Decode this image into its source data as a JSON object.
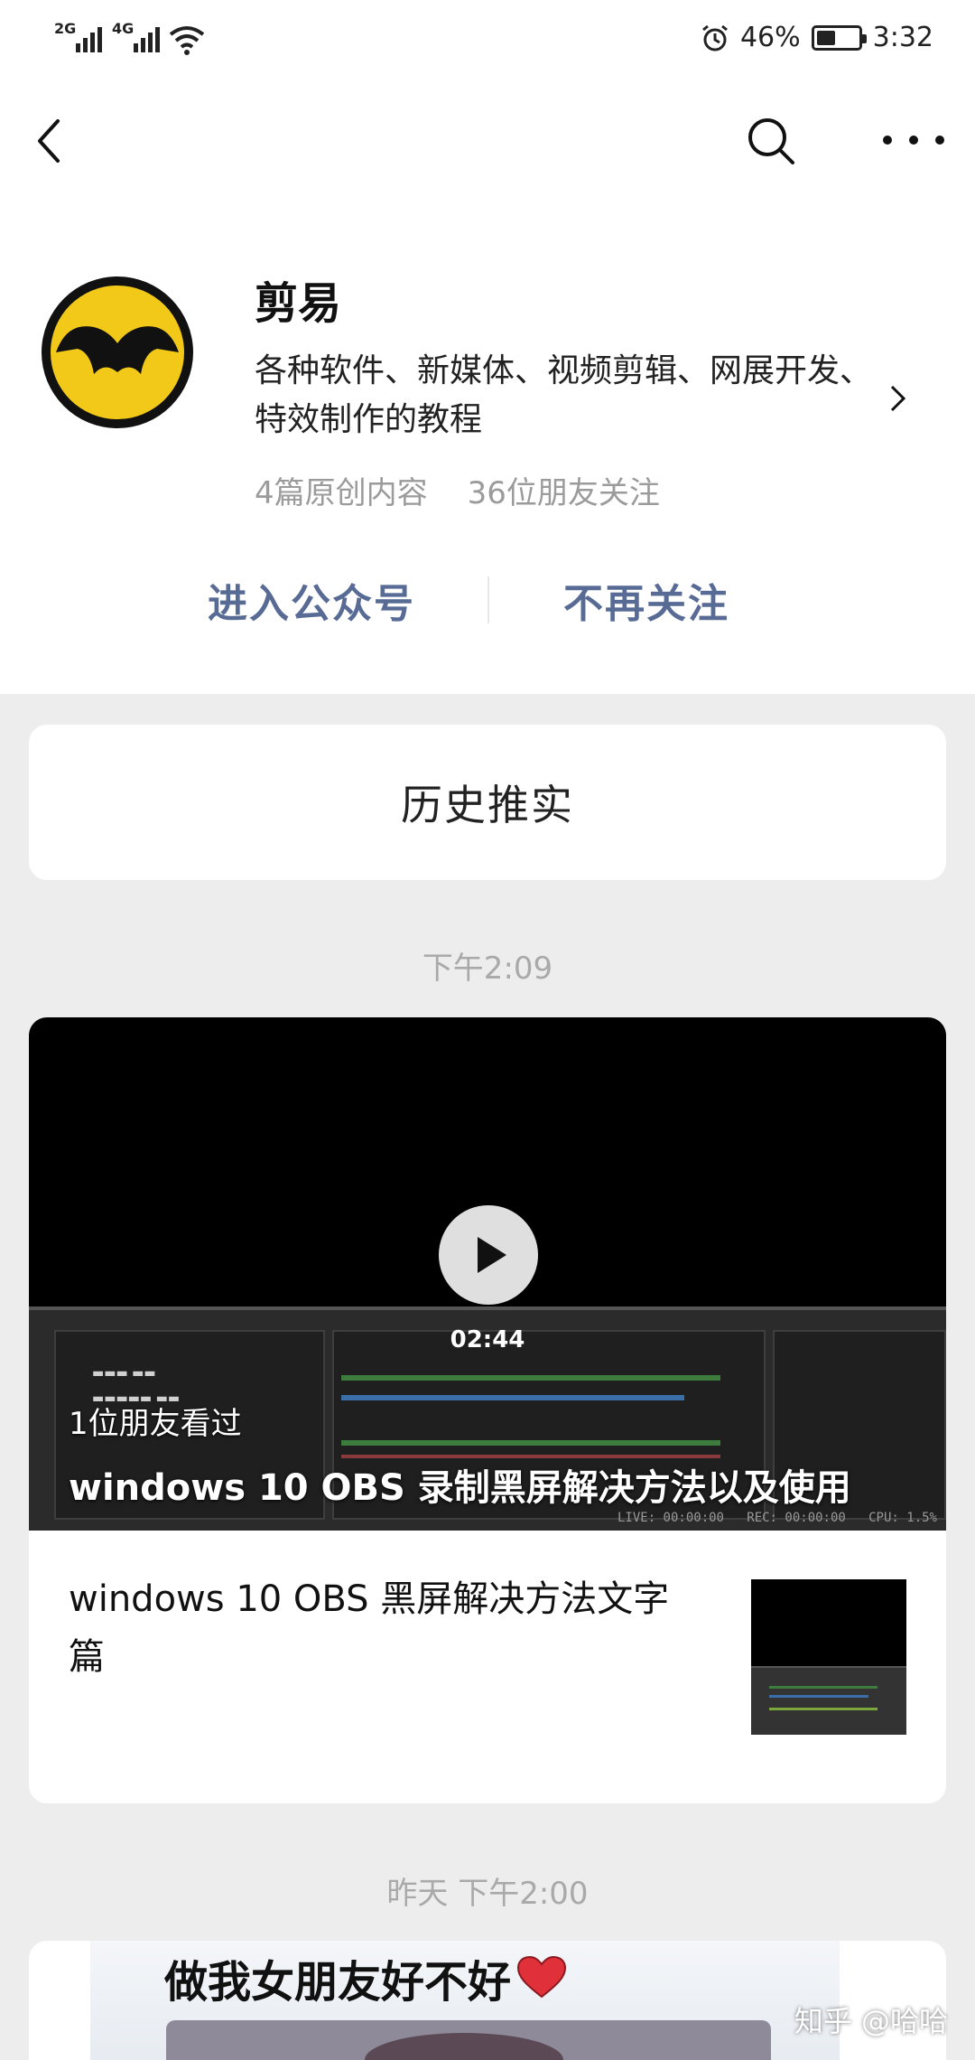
{
  "status_bar": {
    "network1": "2G",
    "network2": "4G",
    "battery_percent": "46%",
    "battery_level": 0.46,
    "time": "3:32"
  },
  "header": {
    "back_icon": "back-icon",
    "search_icon": "search-icon",
    "more_icon": "more-icon"
  },
  "account": {
    "name": "剪易",
    "description": "各种软件、新媒体、视频剪辑、网展开发、特效制作的教程",
    "stats": {
      "original": "4篇原创内容",
      "followers": "36位朋友关注"
    },
    "enter_label": "进入公众号",
    "unfollow_label": "不再关注",
    "brand_colors": {
      "avatar_yellow": "#f2c918",
      "link_blue": "#576b95"
    }
  },
  "history": {
    "label": "历史推实"
  },
  "feed": [
    {
      "time": "下午2:09",
      "video": {
        "duration": "02:44",
        "viewed": "1位朋友看过",
        "title": "windows 10 OBS 录制黑屏解决方法以及使用"
      },
      "sub_article": {
        "title": "windows 10 OBS 黑屏解决方法文字篇"
      }
    },
    {
      "time": "昨天 下午2:00",
      "cover_title": "做我女朋友好不好"
    }
  ],
  "watermark": "知乎 @哈哈"
}
